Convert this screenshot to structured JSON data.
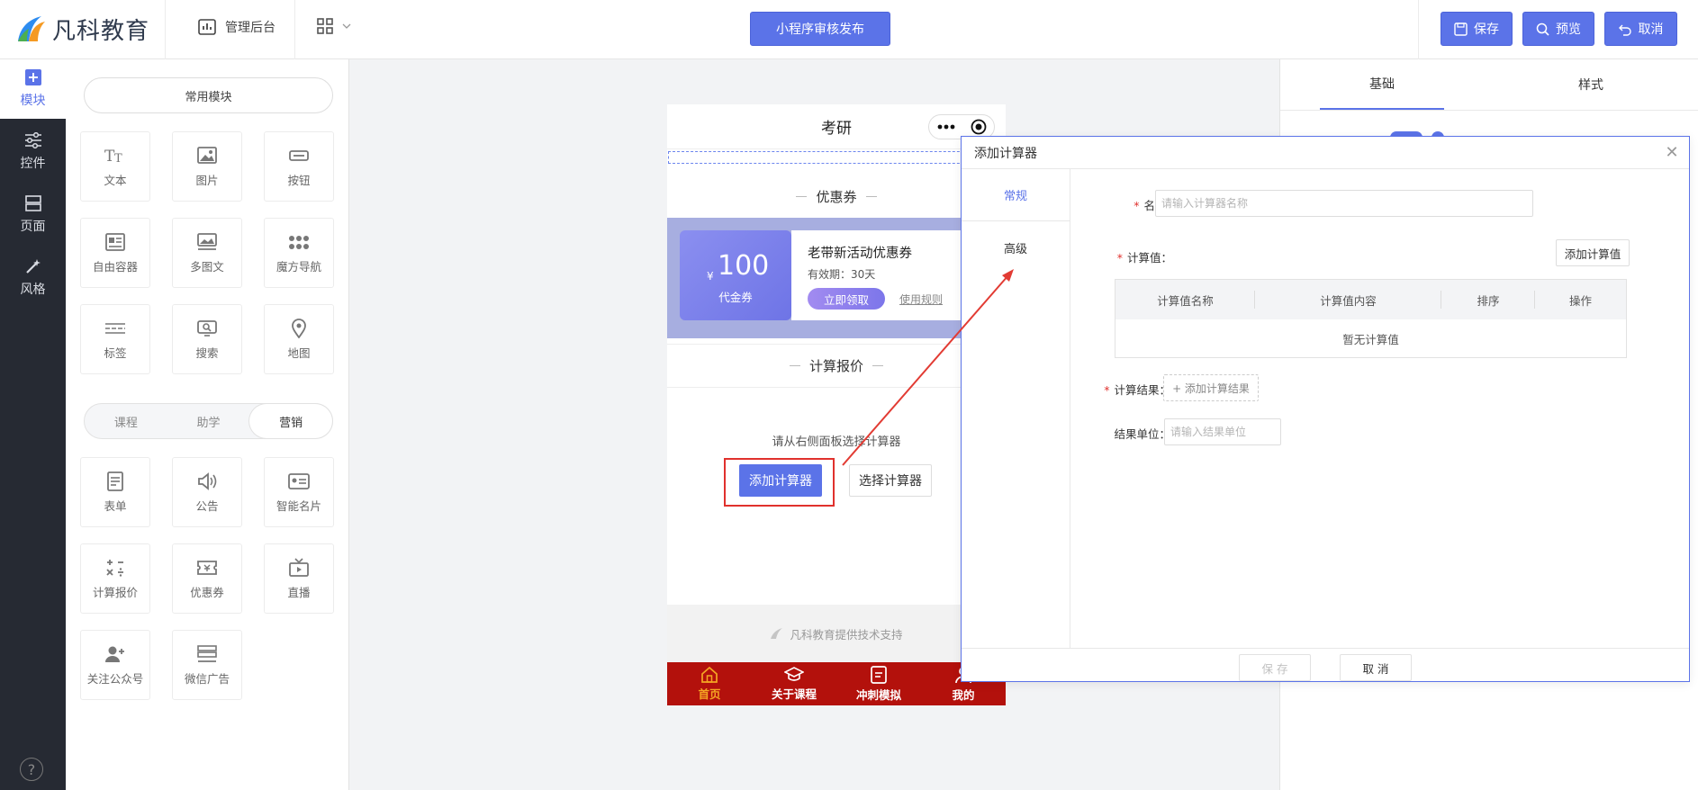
{
  "brand": {
    "name": "凡科教育"
  },
  "topbar": {
    "admin_label": "管理后台",
    "publish_label": "小程序审核发布",
    "save_label": "保存",
    "preview_label": "预览",
    "cancel_label": "取消"
  },
  "sidenav": {
    "items": [
      {
        "label": "模块",
        "icon": "plus-square-icon"
      },
      {
        "label": "控件",
        "icon": "sliders-icon"
      },
      {
        "label": "页面",
        "icon": "pages-icon"
      },
      {
        "label": "风格",
        "icon": "magic-wand-icon"
      }
    ],
    "help": "?"
  },
  "modules": {
    "common_label": "常用模块",
    "common": [
      {
        "label": "文本",
        "icon": "text-icon"
      },
      {
        "label": "图片",
        "icon": "image-icon"
      },
      {
        "label": "按钮",
        "icon": "button-icon"
      },
      {
        "label": "自由容器",
        "icon": "container-icon"
      },
      {
        "label": "多图文",
        "icon": "multi-image-icon"
      },
      {
        "label": "魔方导航",
        "icon": "dots-grid-icon"
      },
      {
        "label": "标签",
        "icon": "tag-lines-icon"
      },
      {
        "label": "搜索",
        "icon": "search-icon"
      },
      {
        "label": "地图",
        "icon": "map-pin-icon"
      }
    ],
    "tabs": [
      "课程",
      "助学",
      "营销"
    ],
    "active_tab": "营销",
    "marketing": [
      {
        "label": "表单",
        "icon": "form-icon"
      },
      {
        "label": "公告",
        "icon": "speaker-icon"
      },
      {
        "label": "智能名片",
        "icon": "card-icon"
      },
      {
        "label": "计算报价",
        "icon": "calculator-icon"
      },
      {
        "label": "优惠券",
        "icon": "coupon-icon"
      },
      {
        "label": "直播",
        "icon": "tv-icon"
      },
      {
        "label": "关注公众号",
        "icon": "user-plus-icon"
      },
      {
        "label": "微信广告",
        "icon": "ad-icon"
      }
    ]
  },
  "phone": {
    "title": "考研",
    "coupon_section": "优惠券",
    "coupon": {
      "currency": "¥",
      "amount": "100",
      "type": "代金券",
      "name": "老带新活动优惠券",
      "validity": "有效期：30天",
      "claim": "立即领取",
      "rules": "使用规则"
    },
    "calc_section": "计算报价",
    "calc_hint": "请从右侧面板选择计算器",
    "add_calc": "添加计算器",
    "select_calc": "选择计算器",
    "support": "凡科教育提供技术支持",
    "tabbar": [
      {
        "label": "首页",
        "icon": "home-icon",
        "active": true
      },
      {
        "label": "关于课程",
        "icon": "graduation-cap-icon",
        "active": false
      },
      {
        "label": "冲刺模拟",
        "icon": "notebook-icon",
        "active": false
      },
      {
        "label": "我的",
        "icon": "user-icon",
        "active": false
      }
    ]
  },
  "rightpanel": {
    "tabs": [
      "基础",
      "样式"
    ]
  },
  "dialog": {
    "title": "添加计算器",
    "nav": [
      "常规",
      "高级"
    ],
    "name_label": "名称：",
    "name_placeholder": "请输入计算器名称",
    "values_label": "计算值：",
    "add_value": "添加计算值",
    "table_headers": [
      "计算值名称",
      "计算值内容",
      "排序",
      "操作"
    ],
    "table_empty": "暂无计算值",
    "result_label": "计算结果：",
    "add_result": "+ 添加计算结果",
    "unit_label": "结果单位：",
    "unit_placeholder": "请输入结果单位",
    "save": "保 存",
    "cancel": "取 消"
  },
  "colors": {
    "accent": "#5b73e8",
    "sidebar": "#262a33",
    "tabbar": "#b3110c",
    "highlight": "#e0312d"
  }
}
